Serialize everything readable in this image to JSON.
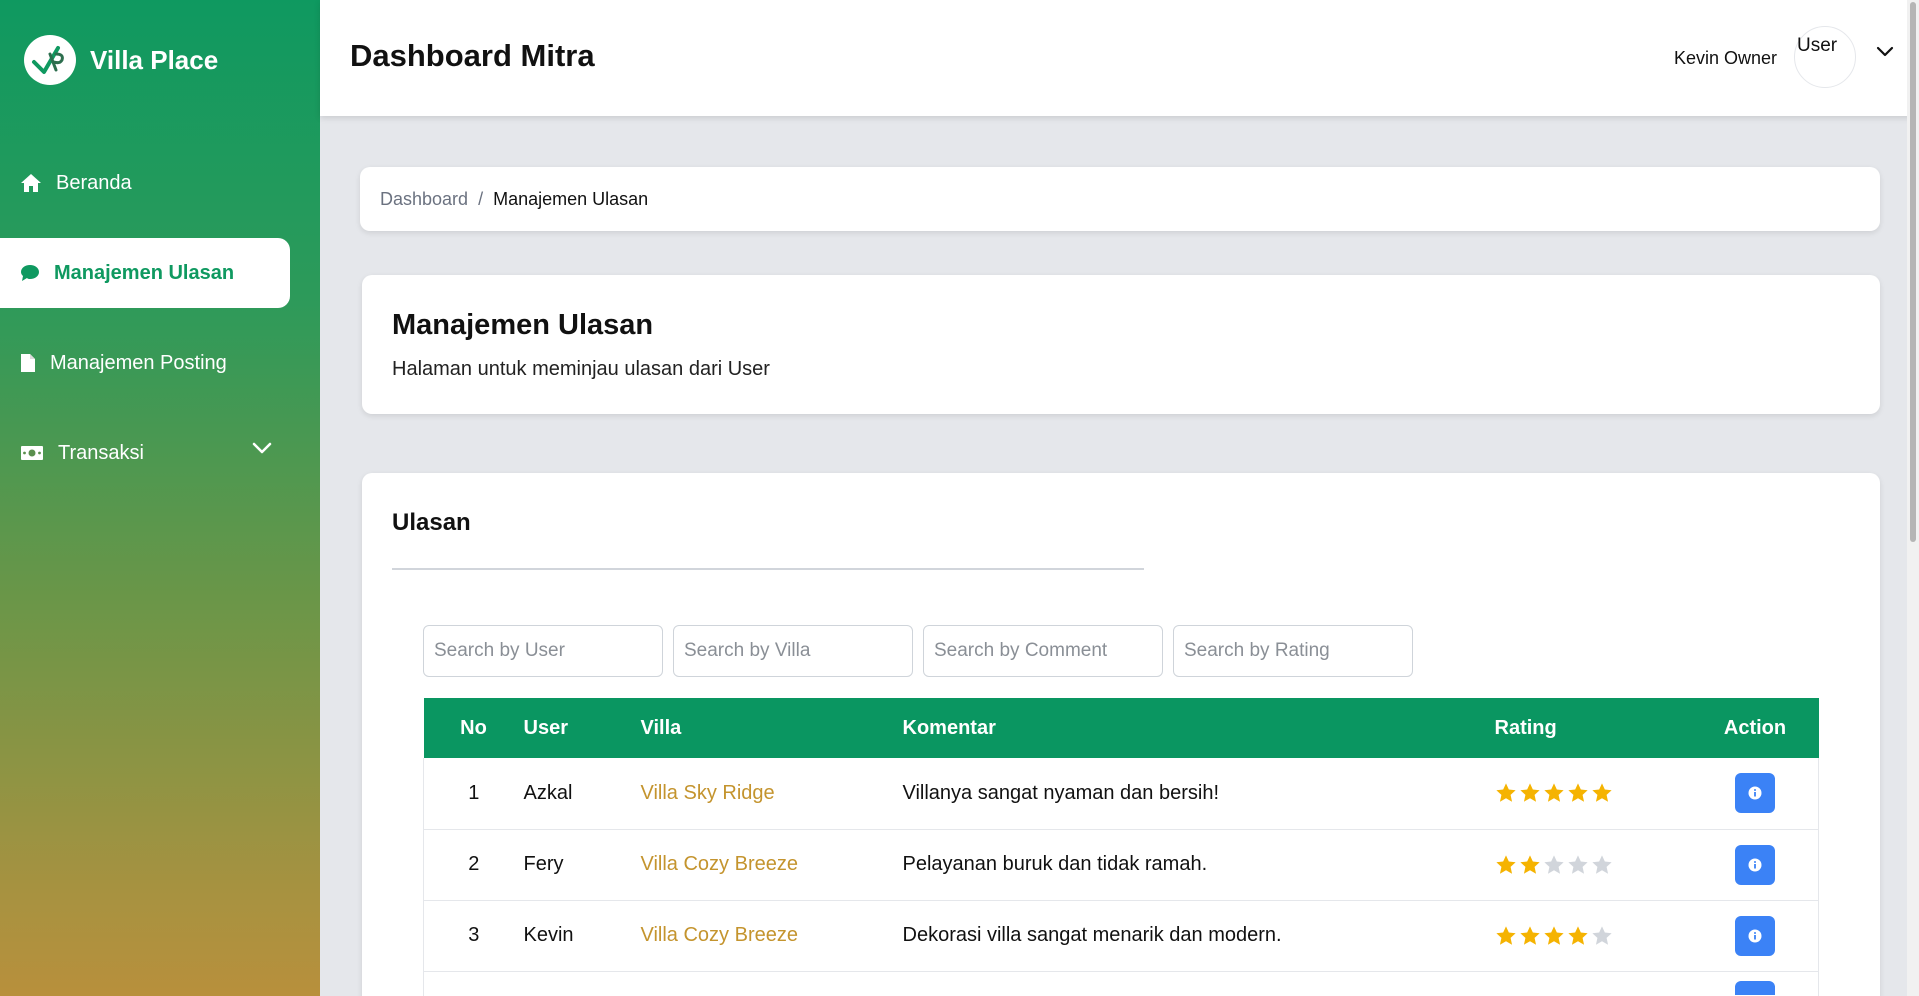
{
  "brand": {
    "name": "Villa Place"
  },
  "sidebar": {
    "items": [
      {
        "label": "Beranda",
        "icon": "home-icon"
      },
      {
        "label": "Manajemen Ulasan",
        "icon": "comment-icon",
        "active": true
      },
      {
        "label": "Manajemen Posting",
        "icon": "file-icon"
      },
      {
        "label": "Transaksi",
        "icon": "money-icon",
        "has_dropdown": true
      }
    ]
  },
  "topbar": {
    "title": "Dashboard Mitra",
    "user_name": "Kevin Owner",
    "avatar_text": "User"
  },
  "breadcrumb": {
    "root": "Dashboard",
    "separator": "/",
    "current": "Manajemen Ulasan"
  },
  "header": {
    "title": "Manajemen Ulasan",
    "subtitle": "Halaman untuk meminjau ulasan dari User"
  },
  "reviews": {
    "title": "Ulasan",
    "search": {
      "user_placeholder": "Search by User",
      "villa_placeholder": "Search by Villa",
      "comment_placeholder": "Search by Comment",
      "rating_placeholder": "Search by Rating"
    },
    "columns": [
      "No",
      "User",
      "Villa",
      "Komentar",
      "Rating",
      "Action"
    ],
    "rows": [
      {
        "no": "1",
        "user": "Azkal",
        "villa": "Villa Sky Ridge",
        "comment": "Villanya sangat nyaman dan bersih!",
        "rating": 5
      },
      {
        "no": "2",
        "user": "Fery",
        "villa": "Villa Cozy Breeze",
        "comment": "Pelayanan buruk dan tidak ramah.",
        "rating": 2
      },
      {
        "no": "3",
        "user": "Kevin",
        "villa": "Villa Cozy Breeze",
        "comment": "Dekorasi villa sangat menarik dan modern.",
        "rating": 4
      }
    ]
  },
  "colors": {
    "primary": "#0a9661",
    "star_filled": "#f5b301",
    "star_empty": "#d1d5db",
    "villa_link": "#c4942e",
    "action_button": "#3b82f6"
  }
}
